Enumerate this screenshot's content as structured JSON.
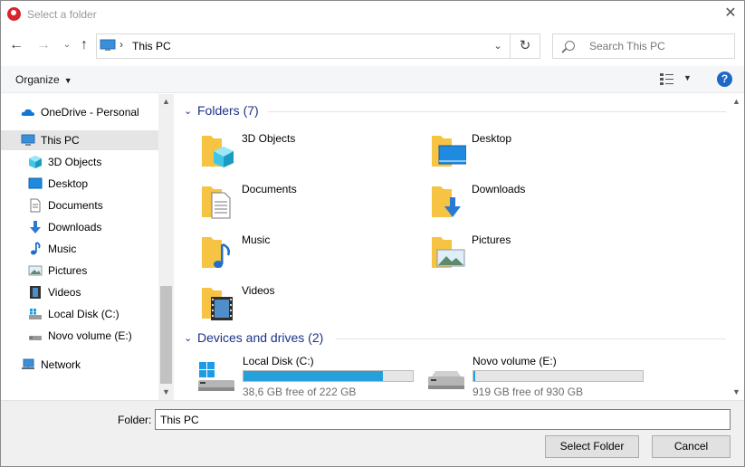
{
  "window": {
    "title": "Select a folder"
  },
  "nav": {
    "address": "This PC",
    "search_placeholder": "Search This PC"
  },
  "toolbar": {
    "organize_label": "Organize"
  },
  "sidebar": {
    "items": [
      {
        "label": "OneDrive - Personal",
        "icon": "onedrive-icon"
      },
      {
        "label": "This PC",
        "icon": "this-pc-icon",
        "selected": true
      },
      {
        "label": "3D Objects",
        "icon": "3d-objects-icon"
      },
      {
        "label": "Desktop",
        "icon": "desktop-icon"
      },
      {
        "label": "Documents",
        "icon": "documents-icon"
      },
      {
        "label": "Downloads",
        "icon": "downloads-icon"
      },
      {
        "label": "Music",
        "icon": "music-icon"
      },
      {
        "label": "Pictures",
        "icon": "pictures-icon"
      },
      {
        "label": "Videos",
        "icon": "videos-icon"
      },
      {
        "label": "Local Disk (C:)",
        "icon": "local-disk-icon"
      },
      {
        "label": "Novo volume (E:)",
        "icon": "drive-icon"
      },
      {
        "label": "Network",
        "icon": "network-icon"
      }
    ]
  },
  "main": {
    "folders_header": "Folders (7)",
    "folders": [
      {
        "label": "3D Objects",
        "icon": "3d-objects-folder-icon"
      },
      {
        "label": "Desktop",
        "icon": "desktop-folder-icon"
      },
      {
        "label": "Documents",
        "icon": "documents-folder-icon"
      },
      {
        "label": "Downloads",
        "icon": "downloads-folder-icon"
      },
      {
        "label": "Music",
        "icon": "music-folder-icon"
      },
      {
        "label": "Pictures",
        "icon": "pictures-folder-icon"
      },
      {
        "label": "Videos",
        "icon": "videos-folder-icon"
      }
    ],
    "drives_header": "Devices and drives (2)",
    "drives": [
      {
        "name": "Local Disk (C:)",
        "free_text": "38,6 GB free of 222 GB",
        "used_fraction": 0.826,
        "icon": "windows-drive-icon"
      },
      {
        "name": "Novo volume (E:)",
        "free_text": "919 GB free of 930 GB",
        "used_fraction": 0.012,
        "icon": "hard-drive-icon"
      }
    ]
  },
  "bottom": {
    "folder_label": "Folder:",
    "folder_value": "This PC",
    "select_label": "Select Folder",
    "cancel_label": "Cancel"
  },
  "colors": {
    "accent": "#1e3287",
    "drive_fill": "#26a0da",
    "selected_bg": "#e5e5e5",
    "folder_yellow": "#f6c342"
  }
}
